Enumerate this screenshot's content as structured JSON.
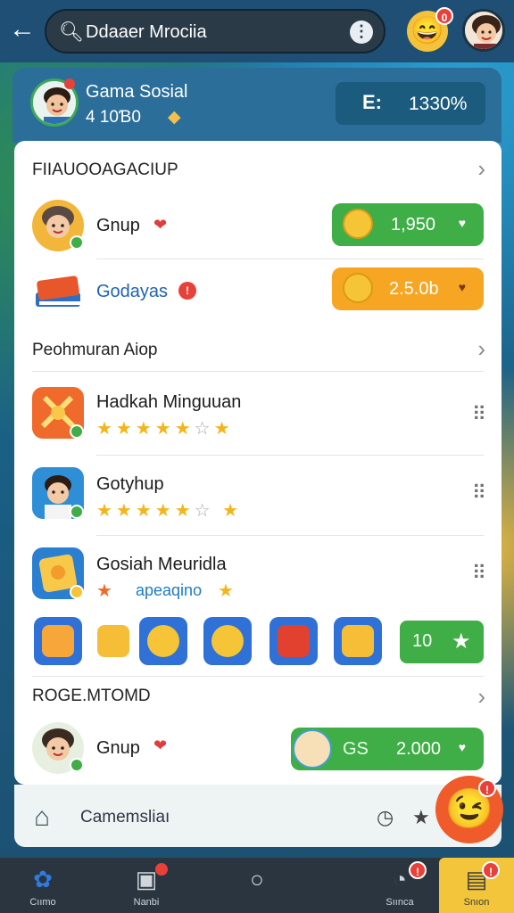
{
  "topbar": {
    "search_text": "Ddaaer Mrociia",
    "more_glyph": "⋮",
    "emoji_badge": "0",
    "avatar_badge": ""
  },
  "header": {
    "title": "Gama Sosial",
    "subtitle": "4 10Ɓ0",
    "score_icon": "E:",
    "score_value": "1330%"
  },
  "section1": {
    "title": "FIIAUOOAGACIUP",
    "rows": [
      {
        "label": "Gnup",
        "value": "1,950",
        "color": "#3fae46"
      },
      {
        "label": "Godayas",
        "value": "2.5.0b",
        "color": "#f6a623"
      }
    ]
  },
  "section2": {
    "title": "Peohmuran Aiop",
    "rows": [
      {
        "label": "Hadkah Minguuan",
        "sub": ""
      },
      {
        "label": "Gotyhup",
        "sub": ""
      },
      {
        "label": "Gosiah Meuridla",
        "sub": "apeaqino"
      }
    ],
    "tiles_button_value": "10"
  },
  "section3": {
    "title": "ROGE.MTOMD",
    "row": {
      "label": "Gnup",
      "tag": "GS",
      "value": "2.000"
    }
  },
  "bottom_bar": {
    "text": "Camemsliaı"
  },
  "nav": {
    "items": [
      {
        "label": "Cıımo"
      },
      {
        "label": "Nanbi"
      },
      {
        "label": ""
      },
      {
        "label": "Sıınca"
      },
      {
        "label": "Snıon"
      }
    ]
  }
}
